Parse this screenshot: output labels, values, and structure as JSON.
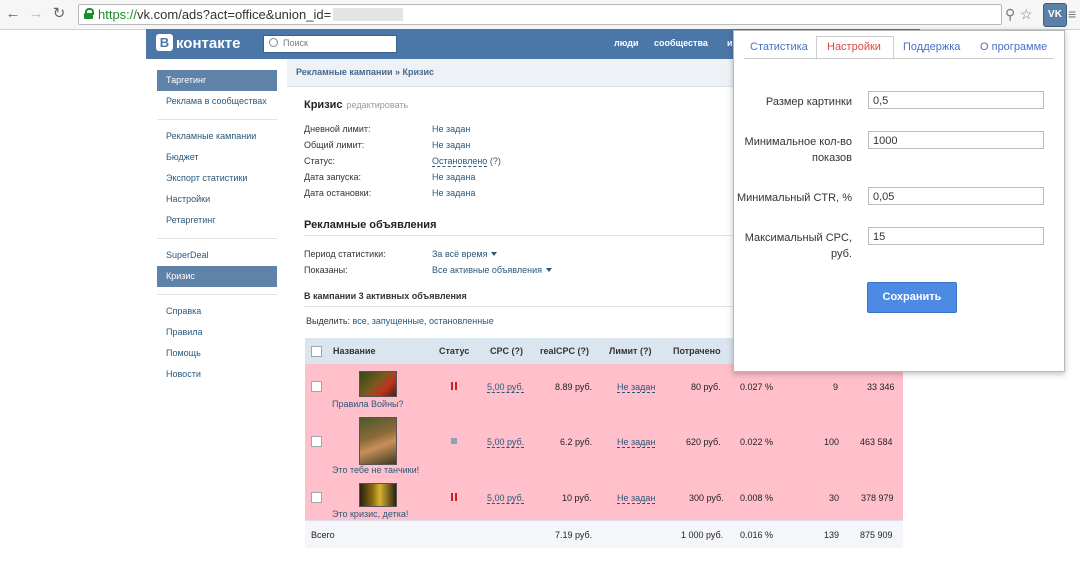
{
  "browser": {
    "url_protocol": "https://",
    "url_rest": "vk.com/ads?act=office&union_id=",
    "ext_label": "VK"
  },
  "vk": {
    "logo": "контакте",
    "logo_letter": "В",
    "search_placeholder": "Поиск",
    "nav": [
      "люди",
      "сообщества",
      "и"
    ]
  },
  "sidebar": {
    "group1": [
      "Таргетинг",
      "Реклама в сообществах"
    ],
    "group2": [
      "Рекламные кампании",
      "Бюджет",
      "Экспорт статистики",
      "Настройки",
      "Ретаргетинг"
    ],
    "group3": [
      "SuperDeal",
      "Кризис"
    ],
    "group4": [
      "Справка",
      "Правила",
      "Помощь",
      "Новости"
    ]
  },
  "campaign": {
    "breadcrumb": "Рекламные кампании » Кризис",
    "title": "Кризис",
    "edit": "редактировать",
    "info": [
      {
        "label": "Дневной лимит:",
        "value": "Не задан"
      },
      {
        "label": "Общий лимит:",
        "value": "Не задан"
      },
      {
        "label": "Статус:",
        "value": "Остановлено",
        "extra": "(?)"
      },
      {
        "label": "Дата запуска:",
        "value": "Не задана"
      },
      {
        "label": "Дата остановки:",
        "value": "Не задана"
      }
    ],
    "ads_section": "Рекламные объявления",
    "period_label": "Период статистики:",
    "period_value": "За всё время",
    "shown_label": "Показаны:",
    "shown_value": "Все активные объявления",
    "ads_count": "В кампании 3 активных объявления",
    "select_label": "Выделить:",
    "select_options": "все, запущенные, остановленные"
  },
  "table": {
    "headers": [
      "Название",
      "Статус",
      "CPC (?)",
      "realCPC (?)",
      "Лимит (?)",
      "Потрачено"
    ],
    "rows": [
      {
        "name": "Правила Войны?",
        "status": "paused",
        "cpc": "5,00 руб.",
        "realcpc": "8.89 руб.",
        "limit": "Не задан",
        "spent": "80 руб.",
        "ctr": "0.027 %",
        "clicks": "9",
        "views": "33 346"
      },
      {
        "name": "Это тебе не танчики!",
        "status": "stopped",
        "cpc": "5,00 руб.",
        "realcpc": "6.2 руб.",
        "limit": "Не задан",
        "spent": "620 руб.",
        "ctr": "0.022 %",
        "clicks": "100",
        "views": "463 584"
      },
      {
        "name": "Это кризис, детка!",
        "status": "paused",
        "cpc": "5,00 руб.",
        "realcpc": "10 руб.",
        "limit": "Не задан",
        "spent": "300 руб.",
        "ctr": "0.008 %",
        "clicks": "30",
        "views": "378 979"
      }
    ],
    "total": {
      "label": "Всего",
      "realcpc": "7.19 руб.",
      "spent": "1 000 руб.",
      "ctr": "0.016 %",
      "clicks": "139",
      "views": "875 909"
    }
  },
  "popup": {
    "tabs": [
      "Статистика",
      "Настройки",
      "Поддержка",
      "О программе"
    ],
    "fields": [
      {
        "label": "Размер картинки",
        "value": "0,5"
      },
      {
        "label": "Минимальное кол-во показов",
        "value": "1000"
      },
      {
        "label": "Минимальный CTR, %",
        "value": "0,05"
      },
      {
        "label": "Максимальный CPC, руб.",
        "value": "15"
      }
    ],
    "save": "Сохранить"
  },
  "colors": {
    "vk_blue": "#4a76a8",
    "row_pink": "#ffc0cb",
    "save_blue": "#4d8ae4",
    "active_tab": "#dd4444"
  }
}
